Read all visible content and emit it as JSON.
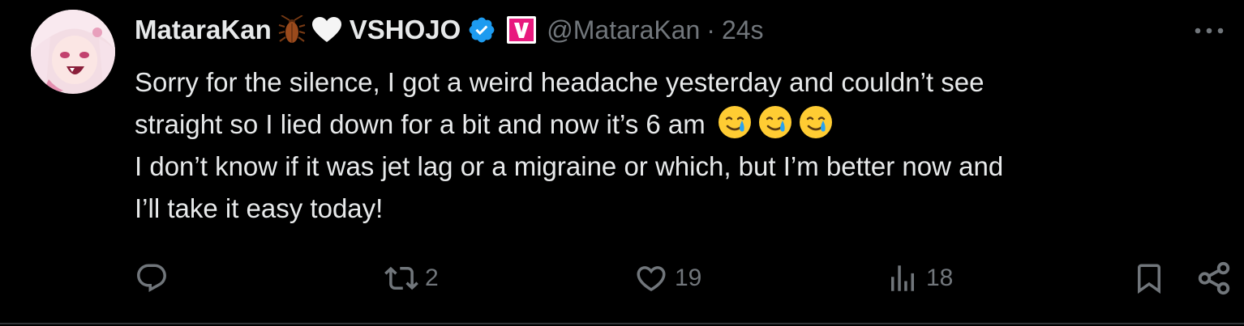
{
  "tweet": {
    "display_name": "MataraKan",
    "affiliation": "VSHOJO",
    "handle": "@MataraKan",
    "separator": "·",
    "timestamp": "24s",
    "text_lines": [
      "Sorry for the silence, I got a weird headache  yesterday and couldn’t see",
      "straight so I lied down for a bit and now it’s 6 am",
      "I don’t know if it was jet lag or a migraine or which, but I’m better now and",
      "I’ll take it easy today!"
    ],
    "emoji_count": 3,
    "emoji_name": "smiling-face-with-tear"
  },
  "icons": {
    "name_icon_1": "cockroach-icon",
    "name_icon_2": "white-heart-icon",
    "verified": "verified-badge-icon",
    "affiliate": "vshojo-affiliate-badge-icon",
    "more": "more-options-icon"
  },
  "actions": {
    "reply": {
      "icon": "reply-icon",
      "count": ""
    },
    "retweet": {
      "icon": "retweet-icon",
      "count": "2"
    },
    "like": {
      "icon": "heart-icon",
      "count": "19"
    },
    "views": {
      "icon": "views-icon",
      "count": "18"
    },
    "bookmark": {
      "icon": "bookmark-icon",
      "count": ""
    },
    "share": {
      "icon": "share-icon",
      "count": ""
    }
  },
  "colors": {
    "background": "#000000",
    "text": "#e7e9ea",
    "secondary": "#71767b",
    "verified_blue": "#1d9bf0",
    "affiliate_pink": "#e8197e",
    "divider": "#2f3336"
  }
}
